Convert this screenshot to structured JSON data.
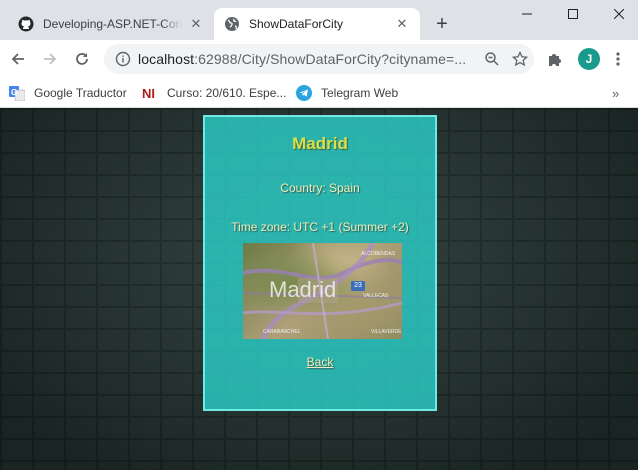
{
  "browser": {
    "tabs": [
      {
        "title": "Developing-ASP.NET-Core-",
        "icon": "github-icon",
        "active": false
      },
      {
        "title": "ShowDataForCity",
        "icon": "globe-icon",
        "active": true
      }
    ],
    "new_tab_label": "+",
    "url_host": "localhost",
    "url_rest": ":62988/City/ShowDataForCity?cityname=...",
    "profile_initial": "J",
    "bookmarks": [
      {
        "label": "Google Traductor",
        "icon": "google-translate-icon"
      },
      {
        "label": "Curso: 20/610. Espe...",
        "icon": "ni-logo-icon"
      },
      {
        "label": "Telegram Web",
        "icon": "telegram-icon"
      }
    ],
    "more_bookmarks": "»"
  },
  "page": {
    "city": "Madrid",
    "country": "Country: Spain",
    "time_zone": "Time zone: UTC +1 (Summer +2)",
    "map_label": "Madrid",
    "map_badge": "23",
    "map_sub_labels": [
      "VALLECAS",
      "CARABANCHEL",
      "VILLAVERDE",
      "ALCOBENDAS"
    ],
    "back_link": "Back"
  },
  "colors": {
    "card_background": "#2bcdc8",
    "heading": "#d8e04a",
    "text": "#ecefb6",
    "profile": "#1a9a8c"
  }
}
